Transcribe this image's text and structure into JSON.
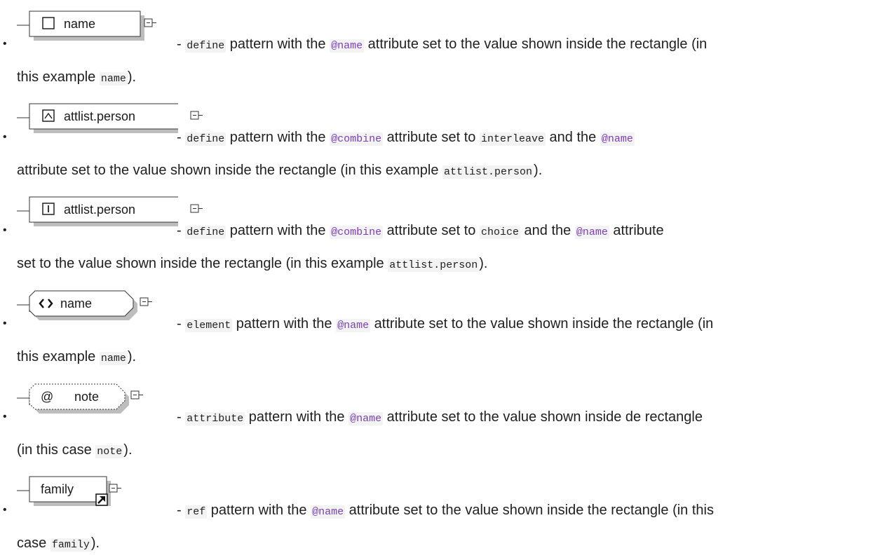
{
  "items": [
    {
      "diagram": {
        "label": "name",
        "icon": "box-empty-icon"
      },
      "desc_dash": "- ",
      "desc_kw": "define",
      "desc_1": " pattern with the ",
      "desc_attr": "@name",
      "desc_2": " attribute set to the value shown inside the rectangle (in",
      "cont_1": "this example ",
      "cont_code": "name",
      "cont_2": ")."
    },
    {
      "diagram": {
        "label": "attlist.person",
        "icon": "combine-interleave-icon"
      },
      "desc_dash": "- ",
      "desc_kw": "define",
      "desc_1": " pattern with the ",
      "desc_attr": "@combine",
      "desc_2": " attribute set to ",
      "desc_val": "interleave",
      "desc_3": " and the ",
      "desc_attr2": "@name",
      "cont_1": "attribute set to the value shown inside the rectangle (in this example ",
      "cont_code": "attlist.person",
      "cont_2": ")."
    },
    {
      "diagram": {
        "label": "attlist.person",
        "icon": "combine-choice-icon"
      },
      "desc_dash": "- ",
      "desc_kw": "define",
      "desc_1": " pattern with the ",
      "desc_attr": "@combine",
      "desc_2": " attribute set to ",
      "desc_val": "choice",
      "desc_3": " and the ",
      "desc_attr2": "@name",
      "desc_4": " attribute",
      "cont_1": "set to the value shown inside the rectangle (in this example ",
      "cont_code": "attlist.person",
      "cont_2": ")."
    },
    {
      "diagram": {
        "label": "name",
        "icon": "element-brackets-icon"
      },
      "desc_dash": "- ",
      "desc_kw": "element",
      "desc_1": " pattern with the ",
      "desc_attr": "@name",
      "desc_2": " attribute set to the value shown inside the rectangle (in",
      "cont_1": "this example ",
      "cont_code": "name",
      "cont_2": ")."
    },
    {
      "diagram": {
        "label": "note",
        "icon": "attribute-at-icon",
        "at_symbol": "@"
      },
      "desc_dash": "- ",
      "desc_kw": "attribute",
      "desc_1": " pattern with the ",
      "desc_attr": "@name",
      "desc_2": " attribute set to the value shown inside de rectangle",
      "cont_1": "(in this case ",
      "cont_code": "note",
      "cont_2": ")."
    },
    {
      "diagram": {
        "label": "family",
        "icon": "ref-arrow-icon"
      },
      "desc_dash": "- ",
      "desc_kw": "ref",
      "desc_1": " pattern with the ",
      "desc_attr": "@name",
      "desc_2": " attribute set to the value shown inside the rectangle (in this",
      "cont_1": "case ",
      "cont_code": "family",
      "cont_2": ")."
    }
  ]
}
